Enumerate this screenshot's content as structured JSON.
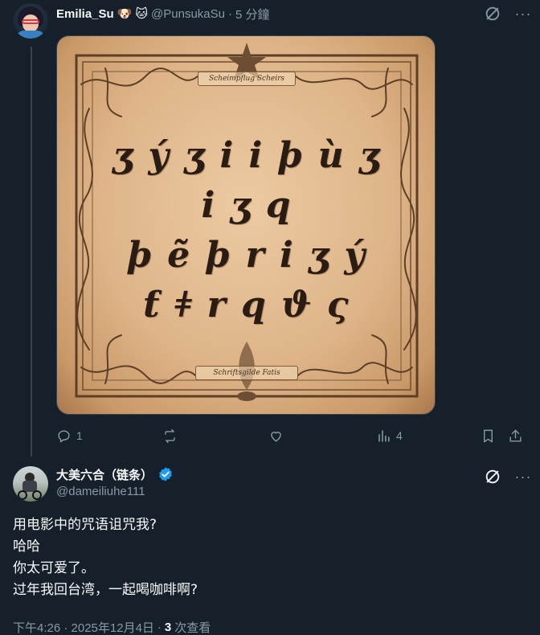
{
  "colors": {
    "background": "#15202b",
    "text_primary": "#f7f9f9",
    "text_secondary": "#8b98a5",
    "verified_blue": "#1d9bf0",
    "thread_line": "#38444d"
  },
  "tweet1": {
    "display_name": "Emilia_Su",
    "emojis": [
      "🐶",
      "🐱"
    ],
    "handle": "@PunsukaSu",
    "separator": "·",
    "timestamp": "5 分鐘",
    "image": {
      "banner_top": "Scheimpflug Scheirs",
      "banner_bottom": "Schriftsgilde Fatis",
      "rune_lines": [
        "ʒ ý  ʒ i  i  þ ù  ʒ i  ʒ q",
        "þ ẽ  þ r i  ʒ ý",
        "ƭ ǂ  r q  ϑ ς"
      ]
    },
    "actions": {
      "reply_count": "1",
      "retweet_count": "",
      "like_count": "",
      "views_count": "4"
    },
    "icons": [
      "grok-icon",
      "more-icon",
      "reply-icon",
      "retweet-icon",
      "like-icon",
      "views-icon",
      "bookmark-icon",
      "share-icon"
    ]
  },
  "tweet2": {
    "display_name": "大美六合（链条）",
    "handle": "@dameiliuhe111",
    "verified": true,
    "body_lines": [
      "用电影中的咒语诅咒我?",
      "哈哈",
      "你太可爱了。",
      "过年我回台湾，一起喝咖啡啊?"
    ],
    "timestamp": "下午4:26 · 2025年12月4日",
    "separator": "·",
    "views_count": "3",
    "views_label": "次查看",
    "icons": [
      "verified-badge-icon",
      "grok-icon",
      "more-icon"
    ]
  }
}
